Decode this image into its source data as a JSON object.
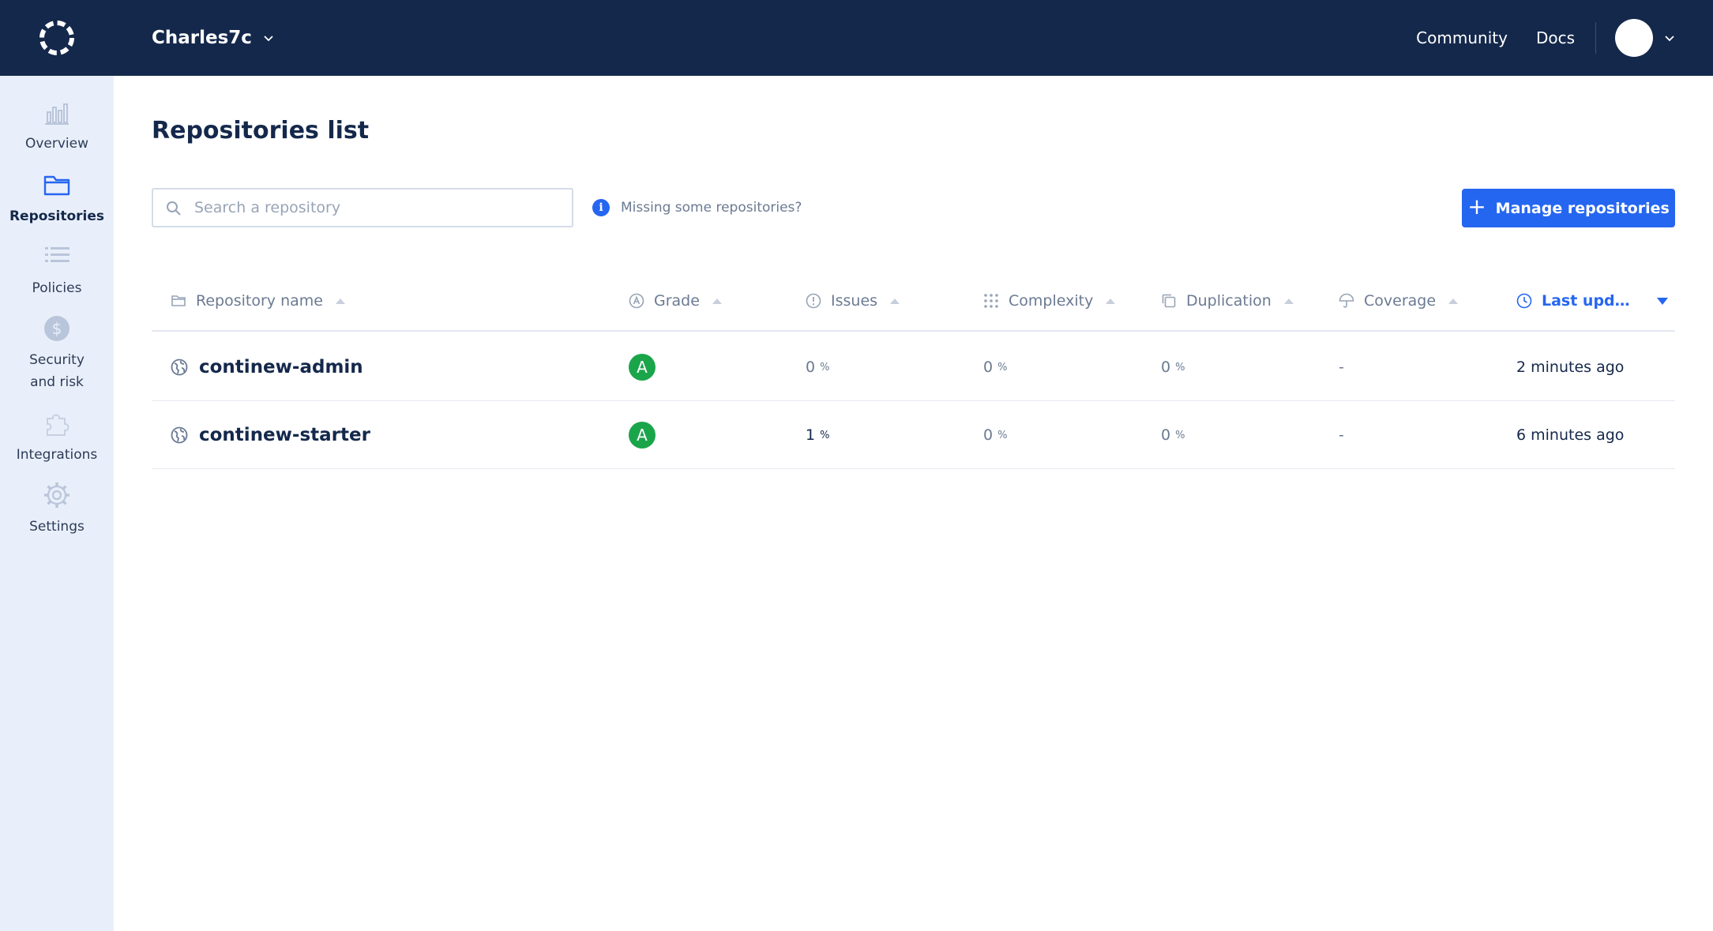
{
  "header": {
    "org_name": "Charles7c",
    "nav": {
      "community": "Community",
      "docs": "Docs"
    }
  },
  "sidebar": {
    "items": [
      {
        "label": "Overview",
        "icon": "chart-icon",
        "active": false
      },
      {
        "label": "Repositories",
        "icon": "folder-icon",
        "active": true
      },
      {
        "label": "Policies",
        "icon": "list-icon",
        "active": false
      },
      {
        "label": "Security\nand risk",
        "icon": "security-icon",
        "active": false
      },
      {
        "label": "Integrations",
        "icon": "puzzle-icon",
        "active": false
      },
      {
        "label": "Settings",
        "icon": "gear-icon",
        "active": false
      }
    ]
  },
  "main": {
    "title": "Repositories list",
    "search": {
      "placeholder": "Search a repository",
      "value": ""
    },
    "missing_text": "Missing some repositories?",
    "manage_button": "Manage repositories"
  },
  "table": {
    "columns": [
      {
        "label": "Repository name",
        "icon": "folder-icon"
      },
      {
        "label": "Grade",
        "icon": "grade-icon"
      },
      {
        "label": "Issues",
        "icon": "alert-circle-icon"
      },
      {
        "label": "Complexity",
        "icon": "grid-dots-icon"
      },
      {
        "label": "Duplication",
        "icon": "copy-icon"
      },
      {
        "label": "Coverage",
        "icon": "umbrella-icon"
      },
      {
        "label": "Last upd…",
        "icon": "clock-icon",
        "active": true,
        "sort": "desc"
      }
    ],
    "rows": [
      {
        "name": "continew-admin",
        "grade": "A",
        "issues": "0",
        "complexity": "0",
        "duplication": "0",
        "coverage": "-",
        "updated": "2 minutes ago"
      },
      {
        "name": "continew-starter",
        "grade": "A",
        "issues": "1",
        "complexity": "0",
        "duplication": "0",
        "coverage": "-",
        "updated": "6 minutes ago"
      }
    ],
    "percent_symbol": "%"
  },
  "colors": {
    "topbar": "#14284b",
    "sidebar": "#e9effa",
    "accent": "#2566f1",
    "grade_a": "#1ba54b"
  }
}
